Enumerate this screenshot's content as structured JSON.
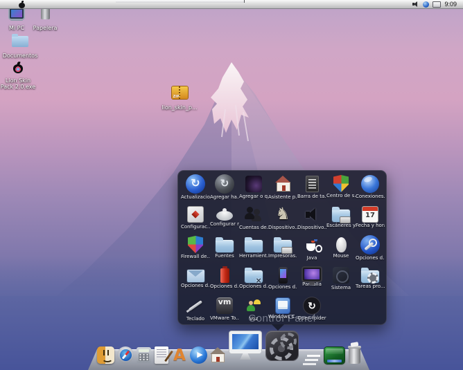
{
  "menu_bar": {
    "clock": "9:09"
  },
  "desktop_icons": [
    {
      "label": "Mi PC",
      "icon": "computer"
    },
    {
      "label": "Papelera",
      "icon": "trash"
    },
    {
      "label": "Documentos",
      "icon": "folder"
    },
    {
      "label": "Lion Skin Pack 2.0.exe",
      "icon": "apple"
    },
    {
      "label": "lion_skin_p...",
      "icon": "zip"
    }
  ],
  "stack_popup": {
    "title": "Control Panel",
    "items": [
      {
        "label": "Actualizacio...",
        "icon": "orb-update"
      },
      {
        "label": "Agregar ha...",
        "icon": "orb-sync"
      },
      {
        "label": "Agregar o q...",
        "icon": "tile-dark"
      },
      {
        "label": "Asistente p...",
        "icon": "house"
      },
      {
        "label": "Barra de ta...",
        "icon": "menu"
      },
      {
        "label": "Centro de s...",
        "icon": "shield"
      },
      {
        "label": "Conexiones...",
        "icon": "orb-globe"
      },
      {
        "label": "Configurac...",
        "icon": "map"
      },
      {
        "label": "Configurar r...",
        "icon": "dome"
      },
      {
        "label": "Cuentas de...",
        "icon": "users"
      },
      {
        "label": "Dispositivo...",
        "icon": "knight"
      },
      {
        "label": "Dispositivo...",
        "icon": "speaker"
      },
      {
        "label": "Escáneres y...",
        "icon": "folder-scanner"
      },
      {
        "label": "Fecha y hora",
        "icon": "calendar"
      },
      {
        "label": "Firewall de...",
        "icon": "shield-color"
      },
      {
        "label": "Fuentes",
        "icon": "folder"
      },
      {
        "label": "Herramient...",
        "icon": "folder"
      },
      {
        "label": "Impresoras...",
        "icon": "folder-printer"
      },
      {
        "label": "Java",
        "icon": "java"
      },
      {
        "label": "Mouse",
        "icon": "mouse"
      },
      {
        "label": "Opciones d...",
        "icon": "orb-wrench"
      },
      {
        "label": "Opciones d...",
        "icon": "mail"
      },
      {
        "label": "Opciones d...",
        "icon": "battery"
      },
      {
        "label": "Opciones d...",
        "icon": "folder-tools"
      },
      {
        "label": "Opciones d...",
        "icon": "phone"
      },
      {
        "label": "Pantalla",
        "icon": "display"
      },
      {
        "label": "Sistema",
        "icon": "tile-faint"
      },
      {
        "label": "Tareas pro...",
        "icon": "folder-gear"
      },
      {
        "label": "Teclado",
        "icon": "pen"
      },
      {
        "label": "VMware To...",
        "icon": "vm"
      },
      {
        "label": "Voz",
        "icon": "voice"
      },
      {
        "label": "Windows C...",
        "icon": "cards"
      },
      {
        "label": "Open folder",
        "icon": "open-circle"
      }
    ]
  },
  "dock": {
    "items": [
      {
        "name": "finder"
      },
      {
        "name": "safari"
      },
      {
        "name": "calculator"
      },
      {
        "name": "textedit"
      },
      {
        "name": "graphics"
      },
      {
        "name": "player"
      },
      {
        "name": "home"
      },
      {
        "name": "computer"
      },
      {
        "name": "system"
      },
      {
        "name": "separator",
        "interactable": false
      },
      {
        "name": "stack"
      },
      {
        "name": "trash"
      }
    ]
  }
}
